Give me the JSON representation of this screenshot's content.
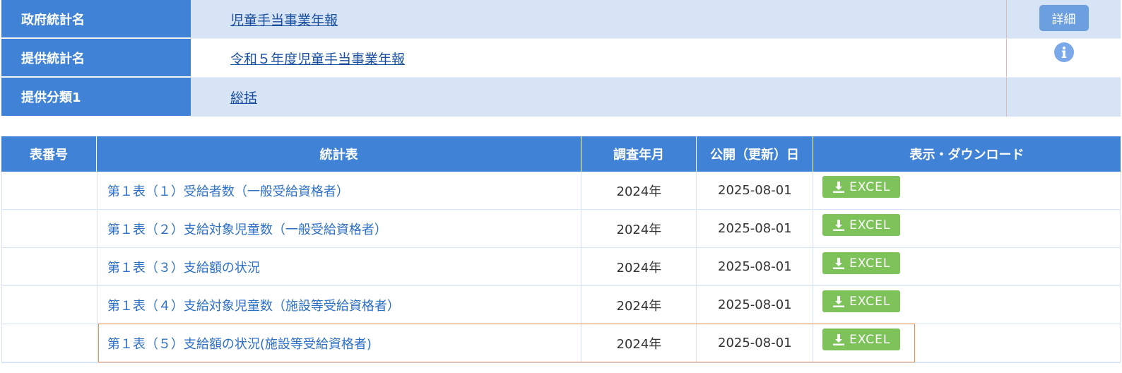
{
  "info": {
    "rows": [
      {
        "label": "政府統計名",
        "value": "児童手当事業年報"
      },
      {
        "label": "提供統計名",
        "value": "令和５年度児童手当事業年報"
      },
      {
        "label": "提供分類1",
        "value": "総括"
      }
    ],
    "detail_label": "詳細",
    "info_icon": "info-circle-icon"
  },
  "stats": {
    "headers": {
      "no": "表番号",
      "table": "統計表",
      "survey_ym": "調査年月",
      "published": "公開（更新）日",
      "download": "表示・ダウンロード"
    },
    "excel_label": "EXCEL",
    "download_icon": "download-icon",
    "rows": [
      {
        "no": "",
        "title": "第１表（１）受給者数（一般受給資格者）",
        "survey_ym": "2024年",
        "published": "2025-08-01"
      },
      {
        "no": "",
        "title": "第１表（２）支給対象児童数（一般受給資格者）",
        "survey_ym": "2024年",
        "published": "2025-08-01"
      },
      {
        "no": "",
        "title": "第１表（３）支給額の状況",
        "survey_ym": "2024年",
        "published": "2025-08-01"
      },
      {
        "no": "",
        "title": "第１表（４）支給対象児童数（施設等受給資格者）",
        "survey_ym": "2024年",
        "published": "2025-08-01"
      },
      {
        "no": "",
        "title": "第１表（５）支給額の状況(施設等受給資格者)",
        "survey_ym": "2024年",
        "published": "2025-08-01"
      }
    ],
    "highlight_color": "#ec8a4a",
    "excel_color": "#7dc35a",
    "header_color": "#3f82d6"
  }
}
